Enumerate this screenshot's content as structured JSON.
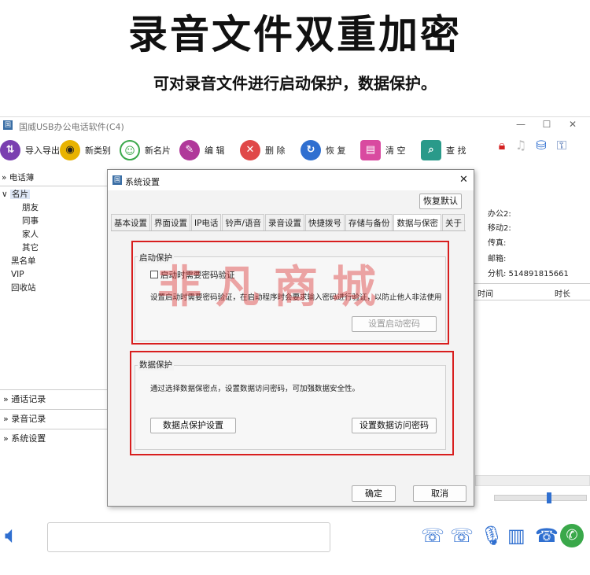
{
  "banner": {
    "headline": "录音文件双重加密",
    "subline": "可对录音文件进行启动保护，数据保护。"
  },
  "app": {
    "title": "国威USB办公电话软件(C4)",
    "toolbar": [
      {
        "icon": "import-export-icon",
        "label": "导入导出",
        "color": "#7a3fb0"
      },
      {
        "icon": "new-category-icon",
        "label": "新类别",
        "color": "#e8b300"
      },
      {
        "icon": "new-card-icon",
        "label": "新名片",
        "color": "#3aa84a"
      },
      {
        "icon": "edit-icon",
        "label": "编 辑",
        "color": "#b0389a"
      },
      {
        "icon": "delete-icon",
        "label": "删 除",
        "color": "#e04848"
      },
      {
        "icon": "restore-icon",
        "label": "恢 复",
        "color": "#2f6fd0"
      },
      {
        "icon": "clear-icon",
        "label": "清 空",
        "color": "#d94aa0"
      },
      {
        "icon": "search-icon",
        "label": "查 找",
        "color": "#2a9a8a"
      }
    ],
    "phonebook": {
      "header": "电话薄",
      "cards_label": "名片",
      "sub_items": [
        "朋友",
        "同事",
        "家人",
        "其它"
      ],
      "other_items": [
        "黑名单",
        "VIP",
        "回收站"
      ]
    },
    "nav": [
      "通话记录",
      "录音记录",
      "系统设置"
    ],
    "contact": {
      "office2": "办公2:",
      "mobile2": "移动2:",
      "fax": "传真:",
      "email": "邮箱:",
      "ext": "分机: 514891815661"
    },
    "table_headers": [
      "时间",
      "时长"
    ]
  },
  "dialog": {
    "title": "系统设置",
    "restore_default": "恢复默认",
    "tabs": [
      "基本设置",
      "界面设置",
      "IP电话",
      "铃声/语音",
      "录音设置",
      "快捷拨号",
      "存储与备份",
      "数据与保密",
      "关于"
    ],
    "active_tab": "数据与保密",
    "startup": {
      "title": "启动保护",
      "checkbox_label": "启动时需要密码验证",
      "description": "设置启动时需要密码验证，在启动程序时会要求输入密码进行验证，以防止他人非法使用",
      "button": "设置启动密码"
    },
    "data": {
      "title": "数据保护",
      "description": "通过选择数据保密点，设置数据访问密码，可加强数据安全性。",
      "button_points": "数据点保护设置",
      "button_password": "设置数据访问密码"
    },
    "ok": "确定",
    "cancel": "取消"
  },
  "watermark": "非凡商城"
}
